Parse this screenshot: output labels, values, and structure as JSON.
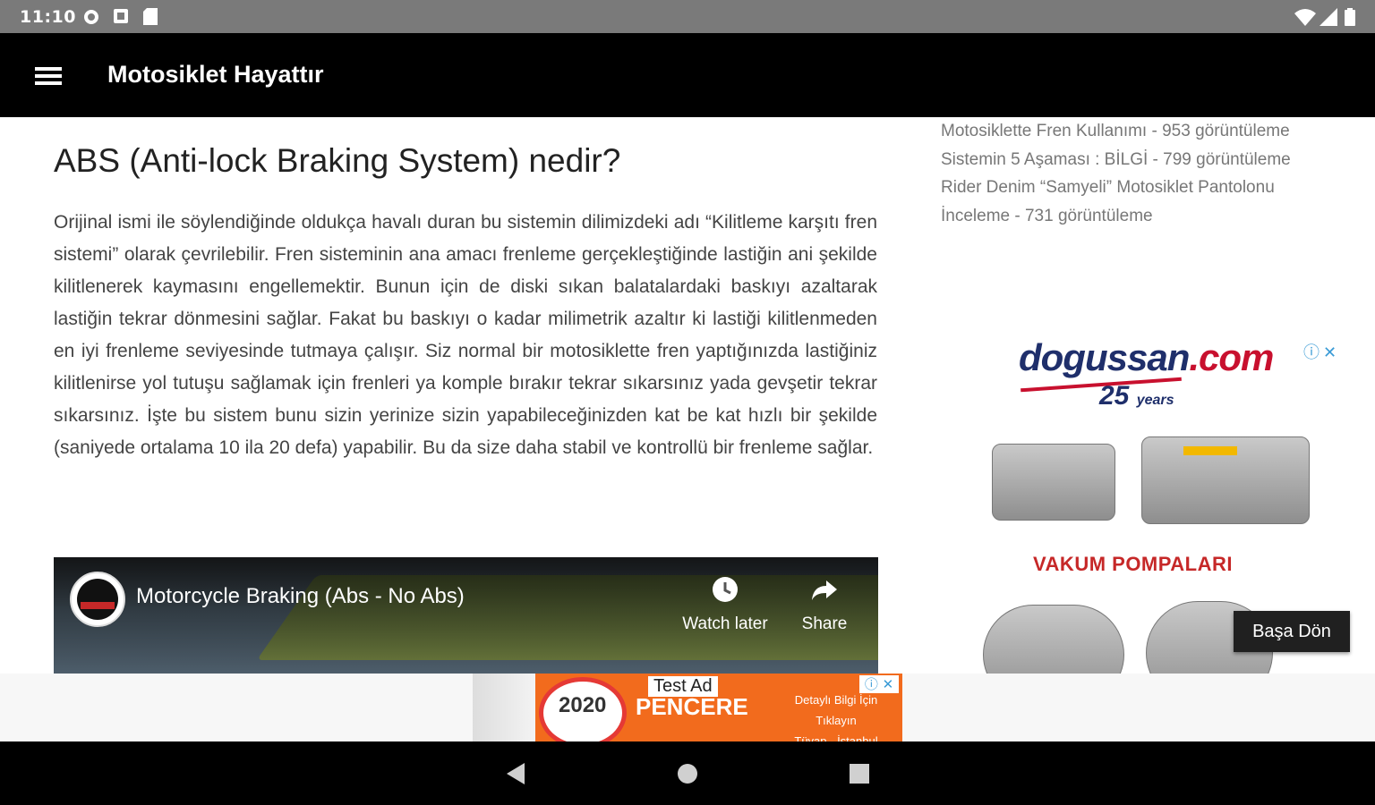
{
  "status_bar": {
    "time": "11:10"
  },
  "app_bar": {
    "title": "Motosiklet Hayattır"
  },
  "article": {
    "title": "ABS (Anti-lock Braking System) nedir?",
    "body": "Orijinal ismi ile söylendiğinde oldukça havalı duran bu sistemin dilimizdeki adı “Kilitleme karşıtı fren sistemi” olarak çevrilebilir. Fren sisteminin ana amacı frenleme gerçekleştiğinde lastiğin ani şekilde kilitlenerek kaymasını engellemektir. Bunun için de diski sıkan balatalardaki baskıyı azaltarak lastiğin tekrar dönmesini sağlar. Fakat bu baskıyı o kadar milimetrik azaltır ki lastiği kilitlenmeden en iyi frenleme seviyesinde tutmaya çalışır. Siz normal bir motosiklette fren yaptığınızda lastiğiniz kilitlenirse yol tutuşu sağlamak için frenleri ya komple bırakır tekrar sıkarsınız yada gevşetir tekrar sıkarsınız. İşte bu sistem bunu sizin yerinize sizin yapabileceğinizden kat be kat hızlı bir şekilde (saniyede ortalama 10 ila 20 defa) yapabilir. Bu da size daha stabil ve kontrollü bir frenleme sağlar."
  },
  "video": {
    "title": "Motorcycle Braking (Abs - No Abs)",
    "watch_later": "Watch later",
    "share": "Share"
  },
  "sidebar": {
    "popular_posts": [
      "Motosiklette Fren Kullanımı - 953 görüntüleme",
      "Sistemin 5 Aşaması : BİLGİ - 799 görüntüleme",
      "Rider Denim “Samyeli” Motosiklet Pantolonu İnceleme - 731 görüntüleme"
    ]
  },
  "sidebar_ad": {
    "brand": "dogussan",
    "brand_suffix": ".com",
    "years": "25",
    "years_word": "years",
    "product": "VAKUM POMPALARI"
  },
  "back_to_top": "Başa Dön",
  "banner_ad": {
    "label": "Test Ad",
    "year": "2020",
    "brand": "PENCERE",
    "cta": "Detaylı Bilgi İçin Tıklayın",
    "location": "Tüyap - İstanbul"
  },
  "colors": {
    "app_bar": "#000000",
    "status_bar": "#7a7a7a",
    "ad_red": "#c62828",
    "ad_navy": "#1f2f6b",
    "banner_orange": "#f26b1d"
  }
}
